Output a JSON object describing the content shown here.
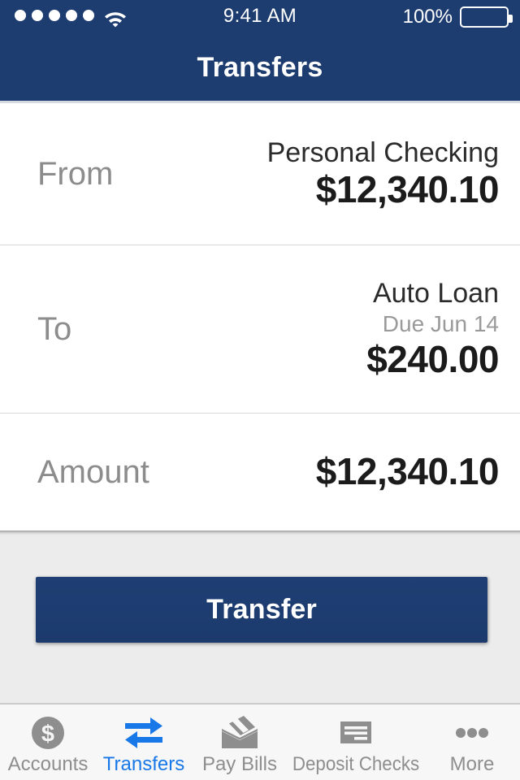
{
  "status_bar": {
    "signal_dots": 5,
    "wifi_icon": "wifi-icon",
    "time": "9:41 AM",
    "battery_percent": "100%",
    "battery_icon": "battery-full-icon"
  },
  "nav": {
    "title": "Transfers"
  },
  "form": {
    "rows": [
      {
        "label": "From",
        "account_name": "Personal Checking",
        "sub": "",
        "amount": "$12,340.10"
      },
      {
        "label": "To",
        "account_name": "Auto Loan",
        "sub": "Due Jun 14",
        "amount": "$240.00"
      },
      {
        "label": "Amount",
        "account_name": "",
        "sub": "",
        "amount": "$12,340.10"
      }
    ]
  },
  "action": {
    "transfer_label": "Transfer"
  },
  "tabbar": {
    "items": [
      {
        "label": "Accounts",
        "icon": "dollar-circle-icon",
        "active": false
      },
      {
        "label": "Transfers",
        "icon": "two-way-arrows-icon",
        "active": true
      },
      {
        "label": "Pay Bills",
        "icon": "envelope-icon",
        "active": false
      },
      {
        "label": "Deposit Checks",
        "icon": "check-document-icon",
        "active": false
      },
      {
        "label": "More",
        "icon": "ellipsis-icon",
        "active": false
      }
    ]
  },
  "colors": {
    "brand_blue": "#1d3c70",
    "accent_blue": "#1878e8",
    "gray_icon": "#8e8e8e",
    "panel_gray": "#ececec"
  }
}
